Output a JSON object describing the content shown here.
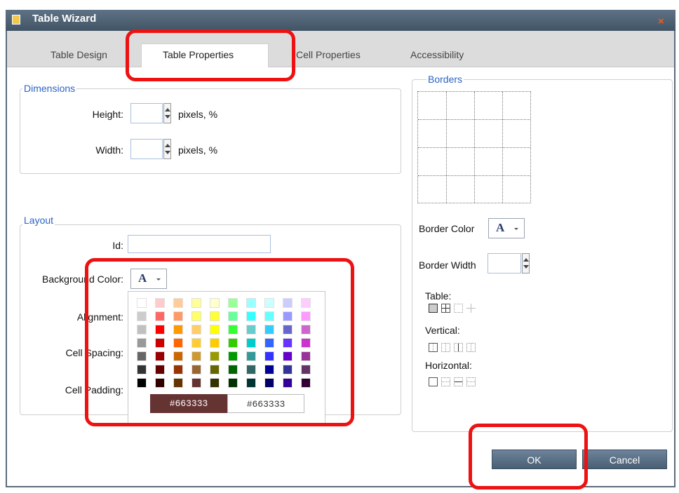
{
  "window": {
    "title": "Table Wizard",
    "close_glyph": "×"
  },
  "tabs": [
    {
      "label": "Table Design"
    },
    {
      "label": "Table Properties"
    },
    {
      "label": "Cell Properties"
    },
    {
      "label": "Accessibility"
    }
  ],
  "dimensions": {
    "legend": "Dimensions",
    "height_label": "Height:",
    "height_value": "",
    "width_label": "Width:",
    "width_value": "",
    "units": "pixels, %"
  },
  "layout": {
    "legend": "Layout",
    "id_label": "Id:",
    "id_value": "",
    "background_color_label": "Background Color:",
    "alignment_label": "Alignment:",
    "cell_spacing_label": "Cell Spacing:",
    "cell_padding_label": "Cell Padding:",
    "color_button_glyph": "A"
  },
  "palette": {
    "selected_color": "#663333",
    "hex_preview": "#663333",
    "hex_input": "#663333",
    "colors": [
      [
        "#ffffff",
        "#ffcccc",
        "#ffcc99",
        "#ffff99",
        "#ffffcc",
        "#99ff99",
        "#99ffff",
        "#ccffff",
        "#ccccff",
        "#ffccff"
      ],
      [
        "#cccccc",
        "#ff6666",
        "#ff9966",
        "#ffff66",
        "#ffff33",
        "#66ff99",
        "#33ffff",
        "#66ffff",
        "#9999ff",
        "#ff99ff"
      ],
      [
        "#c0c0c0",
        "#ff0000",
        "#ff9900",
        "#ffcc66",
        "#ffff00",
        "#33ff33",
        "#66cccc",
        "#33ccff",
        "#6666cc",
        "#cc66cc"
      ],
      [
        "#999999",
        "#cc0000",
        "#ff6600",
        "#ffcc33",
        "#ffcc00",
        "#33cc00",
        "#00cccc",
        "#3366ff",
        "#6633ff",
        "#cc33cc"
      ],
      [
        "#666666",
        "#990000",
        "#cc6600",
        "#cc9933",
        "#999900",
        "#009900",
        "#339999",
        "#3333ff",
        "#6600cc",
        "#993399"
      ],
      [
        "#333333",
        "#660000",
        "#993300",
        "#996633",
        "#666600",
        "#006600",
        "#336666",
        "#000099",
        "#333399",
        "#663366"
      ],
      [
        "#000000",
        "#330000",
        "#663300",
        "#663333",
        "#333300",
        "#003300",
        "#003333",
        "#000066",
        "#330099",
        "#330033"
      ]
    ]
  },
  "borders": {
    "legend": "Borders",
    "border_color_label": "Border Color",
    "border_width_label": "Border Width",
    "border_width_value": "",
    "table_label": "Table:",
    "vertical_label": "Vertical:",
    "horizontal_label": "Horizontal:"
  },
  "buttons": {
    "ok": "OK",
    "cancel": "Cancel"
  },
  "colors": {
    "accent_blue": "#2a63c6",
    "titlebar": "#4b5e71",
    "highlight_red": "#ee1111"
  }
}
